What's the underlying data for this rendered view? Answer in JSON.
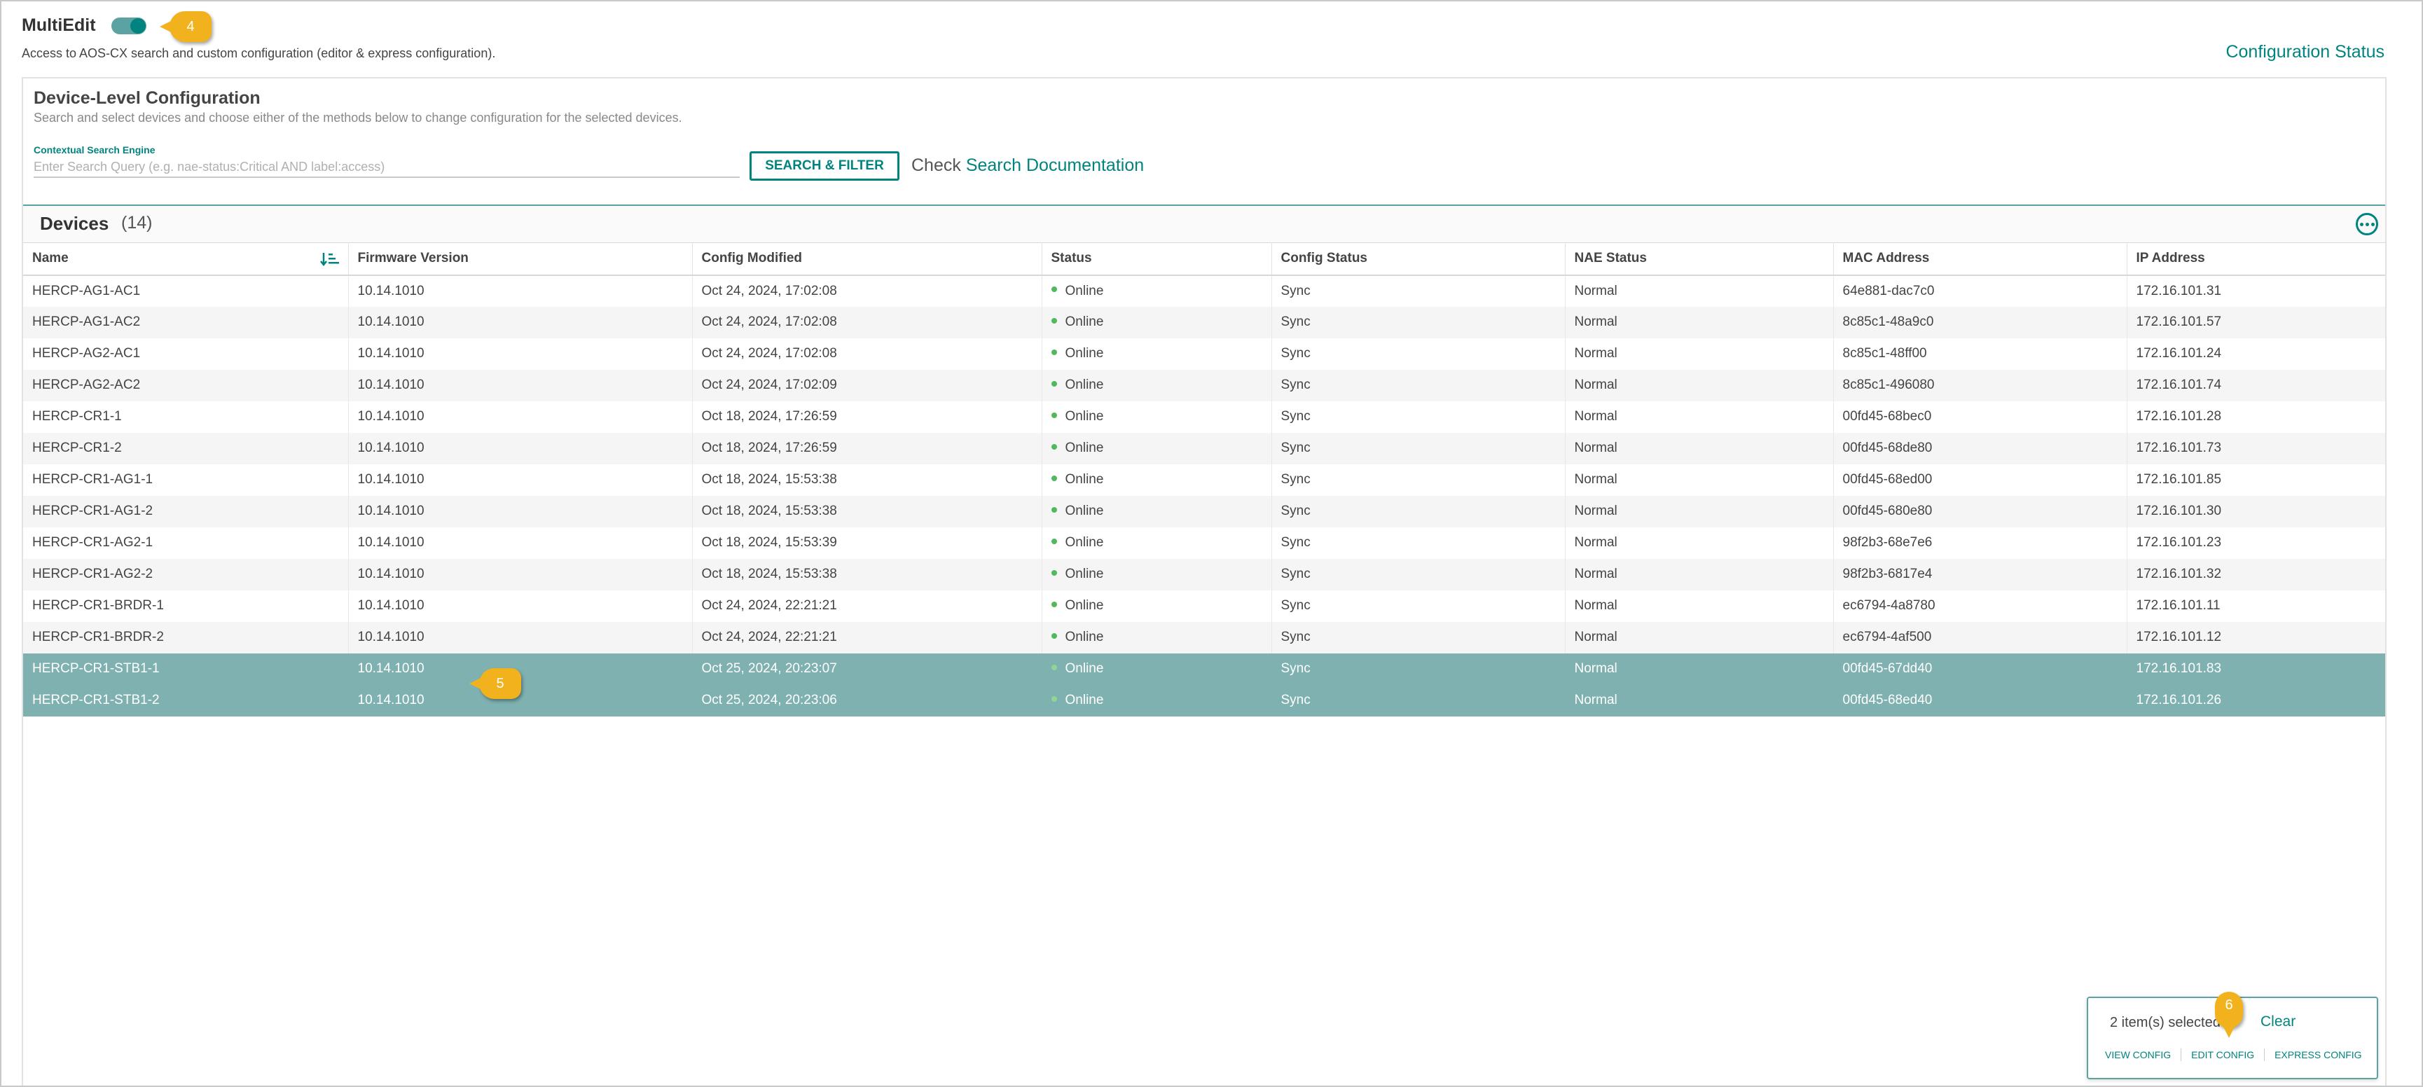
{
  "header": {
    "title": "MultiEdit",
    "toggle_on": true,
    "description": "Access to AOS-CX search and custom configuration (editor & express configuration).",
    "config_status_link": "Configuration Status"
  },
  "callouts": {
    "c4": "4",
    "c5": "5",
    "c6": "6"
  },
  "device_level": {
    "title": "Device-Level Configuration",
    "description": "Search and select devices and choose either of the methods below to change configuration for the selected devices.",
    "search_label": "Contextual Search Engine",
    "search_placeholder": "Enter Search Query (e.g. nae-status:Critical AND label:access)",
    "search_value": "",
    "search_button": "SEARCH & FILTER",
    "check_prefix": "Check",
    "doc_link": "Search Documentation"
  },
  "devices": {
    "title": "Devices",
    "count": "(14)",
    "columns": [
      "Name",
      "Firmware Version",
      "Config Modified",
      "Status",
      "Config Status",
      "NAE Status",
      "MAC Address",
      "IP Address"
    ],
    "rows": [
      [
        "HERCP-AG1-AC1",
        "10.14.1010",
        "Oct 24, 2024, 17:02:08",
        "Online",
        "Sync",
        "Normal",
        "64e881-dac7c0",
        "172.16.101.31"
      ],
      [
        "HERCP-AG1-AC2",
        "10.14.1010",
        "Oct 24, 2024, 17:02:08",
        "Online",
        "Sync",
        "Normal",
        "8c85c1-48a9c0",
        "172.16.101.57"
      ],
      [
        "HERCP-AG2-AC1",
        "10.14.1010",
        "Oct 24, 2024, 17:02:08",
        "Online",
        "Sync",
        "Normal",
        "8c85c1-48ff00",
        "172.16.101.24"
      ],
      [
        "HERCP-AG2-AC2",
        "10.14.1010",
        "Oct 24, 2024, 17:02:09",
        "Online",
        "Sync",
        "Normal",
        "8c85c1-496080",
        "172.16.101.74"
      ],
      [
        "HERCP-CR1-1",
        "10.14.1010",
        "Oct 18, 2024, 17:26:59",
        "Online",
        "Sync",
        "Normal",
        "00fd45-68bec0",
        "172.16.101.28"
      ],
      [
        "HERCP-CR1-2",
        "10.14.1010",
        "Oct 18, 2024, 17:26:59",
        "Online",
        "Sync",
        "Normal",
        "00fd45-68de80",
        "172.16.101.73"
      ],
      [
        "HERCP-CR1-AG1-1",
        "10.14.1010",
        "Oct 18, 2024, 15:53:38",
        "Online",
        "Sync",
        "Normal",
        "00fd45-68ed00",
        "172.16.101.85"
      ],
      [
        "HERCP-CR1-AG1-2",
        "10.14.1010",
        "Oct 18, 2024, 15:53:38",
        "Online",
        "Sync",
        "Normal",
        "00fd45-680e80",
        "172.16.101.30"
      ],
      [
        "HERCP-CR1-AG2-1",
        "10.14.1010",
        "Oct 18, 2024, 15:53:39",
        "Online",
        "Sync",
        "Normal",
        "98f2b3-68e7e6",
        "172.16.101.23"
      ],
      [
        "HERCP-CR1-AG2-2",
        "10.14.1010",
        "Oct 18, 2024, 15:53:38",
        "Online",
        "Sync",
        "Normal",
        "98f2b3-6817e4",
        "172.16.101.32"
      ],
      [
        "HERCP-CR1-BRDR-1",
        "10.14.1010",
        "Oct 24, 2024, 22:21:21",
        "Online",
        "Sync",
        "Normal",
        "ec6794-4a8780",
        "172.16.101.11"
      ],
      [
        "HERCP-CR1-BRDR-2",
        "10.14.1010",
        "Oct 24, 2024, 22:21:21",
        "Online",
        "Sync",
        "Normal",
        "ec6794-4af500",
        "172.16.101.12"
      ],
      [
        "HERCP-CR1-STB1-1",
        "10.14.1010",
        "Oct 25, 2024, 20:23:07",
        "Online",
        "Sync",
        "Normal",
        "00fd45-67dd40",
        "172.16.101.83"
      ],
      [
        "HERCP-CR1-STB1-2",
        "10.14.1010",
        "Oct 25, 2024, 20:23:06",
        "Online",
        "Sync",
        "Normal",
        "00fd45-68ed40",
        "172.16.101.26"
      ]
    ],
    "selected_rows": [
      12,
      13
    ]
  },
  "selection": {
    "count_text": "2 item(s) selected",
    "clear": "Clear",
    "actions": [
      "VIEW CONFIG",
      "EDIT CONFIG",
      "EXPRESS CONFIG"
    ]
  },
  "colors": {
    "accent": "#01847f",
    "selected_row": "#7fb1b1",
    "online_dot": "#52b85c",
    "callout": "#f2b21d"
  }
}
